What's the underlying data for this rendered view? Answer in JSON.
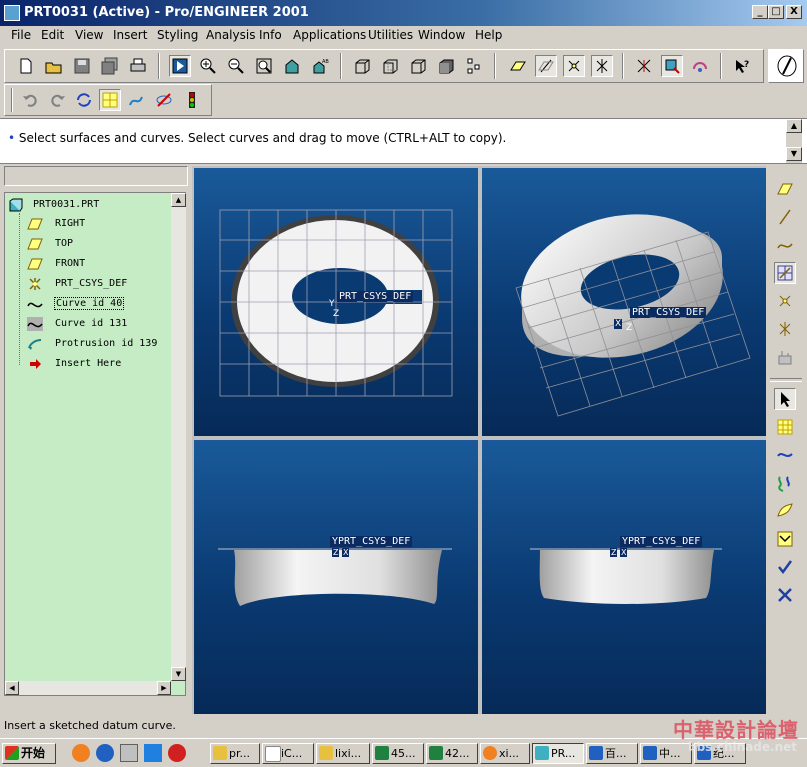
{
  "window": {
    "title": "PRT0031 (Active) - Pro/ENGINEER 2001",
    "controls": [
      "_",
      "□",
      "X"
    ]
  },
  "menu": [
    "File",
    "Edit",
    "View",
    "Insert",
    "Styling",
    "Analysis",
    "Info",
    "Applications",
    "Utilities",
    "Window",
    "Help"
  ],
  "message": {
    "bullet": "•",
    "text": "Select surfaces and curves.  Select curves and drag to move (CTRL+ALT to copy)."
  },
  "tree": {
    "root": "PRT0031.PRT",
    "items": [
      {
        "label": "RIGHT",
        "icon": "datum-plane-icon"
      },
      {
        "label": "TOP",
        "icon": "datum-plane-icon"
      },
      {
        "label": "FRONT",
        "icon": "datum-plane-icon"
      },
      {
        "label": "PRT_CSYS_DEF",
        "icon": "csys-icon"
      },
      {
        "label": "Curve id 40",
        "icon": "curve-icon",
        "selected": true
      },
      {
        "label": "Curve id 131",
        "icon": "curve-icon"
      },
      {
        "label": "Protrusion id 139",
        "icon": "protrusion-icon"
      },
      {
        "label": "Insert Here",
        "icon": "insert-arrow-icon"
      }
    ]
  },
  "viewports": {
    "top_left_label": "PRT_CSYS_DEF",
    "top_right_label": "PRT_CSYS_DEF",
    "bottom_left_label": "YPRT_CSYS_DEF",
    "bottom_right_label": "YPRT_CSYS_DEF",
    "axis_y": "Y",
    "axis_x": "X",
    "axis_z": "Z"
  },
  "status": {
    "text": "Insert a sketched datum curve."
  },
  "taskbar": {
    "start": "开始",
    "items": [
      "pr...",
      "iC...",
      "lixi...",
      "45...",
      "42...",
      "xi...",
      "PR...",
      "百...",
      "中...",
      "纪..."
    ],
    "active_index": 6
  },
  "watermark": {
    "title": "中華設計論壇",
    "url": "bbs.chinade.net"
  },
  "colors": {
    "titlebar": "#0a246a",
    "tree_bg": "#c6ecc6",
    "viewport_bg": "#0a3a72",
    "datum_yellow": "#ffff80"
  }
}
